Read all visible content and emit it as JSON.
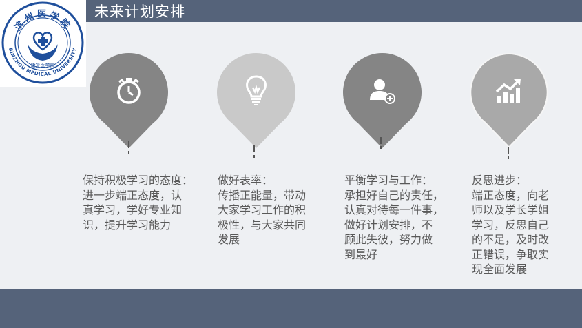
{
  "slide": {
    "title": "未来计划安排",
    "band_color": "#55637a",
    "background_color": "#eef0f3"
  },
  "logo": {
    "name_text": "滨州医学院",
    "english_text": "BINZHOU MEDICAL UNIVERSITY",
    "sub_text": "康复医学院",
    "color": "#1f4f9c"
  },
  "cards": [
    {
      "pin_color": "#858585",
      "icon": "stopwatch-icon",
      "heading": "保持积极学习的态度：",
      "lines": [
        "进一步端正态度，认",
        "真学习，学好专业知",
        "识，提升学习能力"
      ]
    },
    {
      "pin_color": "#c9c9c9",
      "icon": "lightbulb-icon",
      "heading": "做好表率：",
      "lines": [
        "传播正能量，带动",
        "大家学习工作的积",
        "极性，与大家共同",
        "发展"
      ]
    },
    {
      "pin_color": "#858585",
      "icon": "add-user-icon",
      "heading": "平衡学习与工作：",
      "lines": [
        "承担好自己的责任，",
        "认真对待每一件事，",
        "做好计划安排，不",
        "顾此失彼，努力做",
        "到最好"
      ]
    },
    {
      "pin_color": "#a9a9a9",
      "icon": "growth-chart-icon",
      "heading": "反思进步：",
      "lines": [
        "端正态度，向老",
        "师以及学长学姐",
        "学习，反思自己",
        "的不足，及时改",
        "正错误，争取实",
        "现全面发展"
      ]
    }
  ]
}
